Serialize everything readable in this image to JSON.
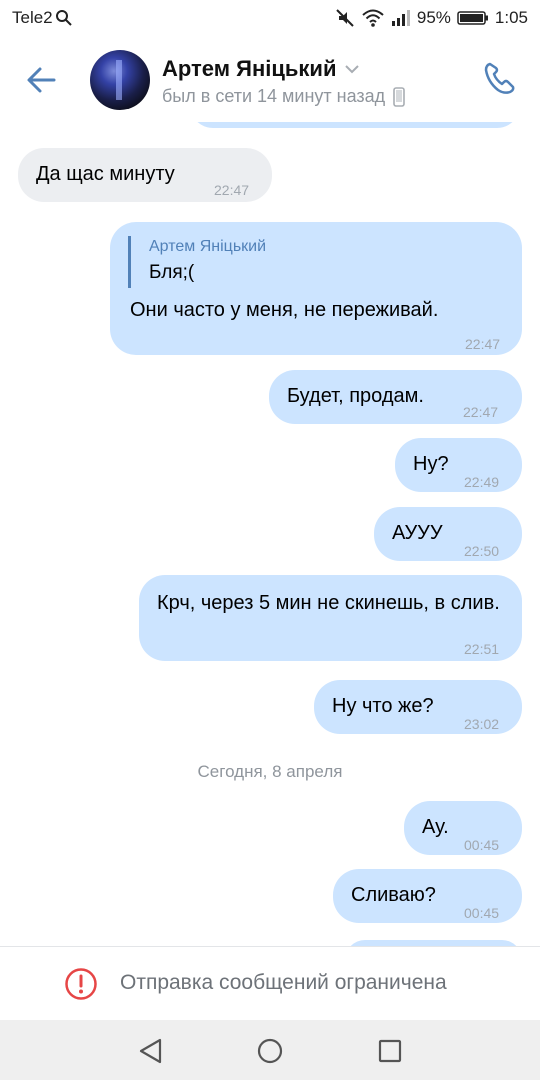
{
  "status_bar": {
    "carrier": "Tele2",
    "battery_percent": "95%",
    "time": "1:05",
    "icons": [
      "search-icon",
      "mute-icon",
      "wifi-icon",
      "signal-icon",
      "battery-icon"
    ]
  },
  "header": {
    "name": "Артем Яніцький",
    "status": "был в сети 14 минут назад",
    "icons": [
      "back-arrow-icon",
      "chevron-down-icon",
      "phone-small-icon",
      "call-icon"
    ]
  },
  "messages": [
    {
      "text": "Да щас минуту",
      "time": "22:47",
      "direction": "in"
    },
    {
      "reply_author": "Артем Яніцький",
      "reply_text": "Бля;(",
      "text": "Они часто у меня, не переживай.",
      "time": "22:47",
      "direction": "out"
    },
    {
      "text": "Будет, продам.",
      "time": "22:47",
      "direction": "out"
    },
    {
      "text": "Ну?",
      "time": "22:49",
      "direction": "out"
    },
    {
      "text": "АУУУ",
      "time": "22:50",
      "direction": "out"
    },
    {
      "text": "Крч, через 5 мин не скинешь, в слив.",
      "time": "22:51",
      "direction": "out"
    },
    {
      "text": "Ну что же?",
      "time": "23:02",
      "direction": "out"
    },
    {
      "text": "Ау.",
      "time": "00:45",
      "direction": "out"
    },
    {
      "text": "Сливаю?",
      "time": "00:45",
      "direction": "out"
    }
  ],
  "date_separator": "Сегодня, 8 апреля",
  "restriction": {
    "text": "Отправка сообщений ограничена",
    "icon": "warning-icon",
    "color": "#e64646"
  },
  "nav": {
    "icons": [
      "nav-back-icon",
      "nav-home-icon",
      "nav-recents-icon"
    ]
  },
  "colors": {
    "accent": "#5181b8",
    "outgoing_bubble": "#cce4ff",
    "incoming_bubble": "#eceef1"
  }
}
